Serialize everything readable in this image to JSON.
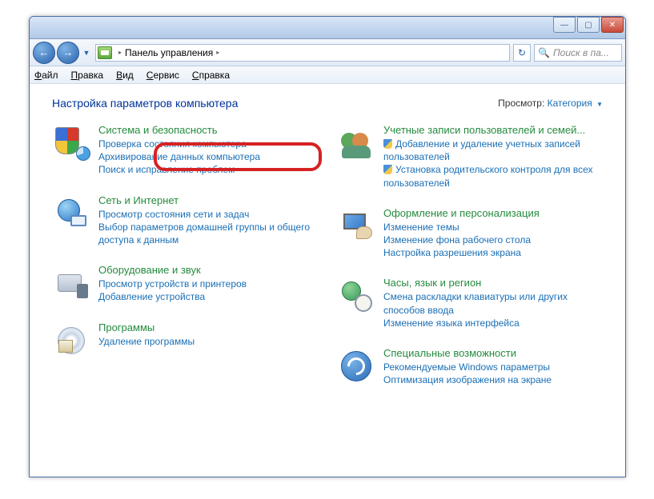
{
  "window_controls": {
    "min": "—",
    "max": "▢",
    "close": "✕"
  },
  "nav": {
    "back": "←",
    "forward": "→",
    "dropdown": "▼",
    "refresh": "↻"
  },
  "breadcrumb": {
    "root": "Панель управления",
    "sep": "▸"
  },
  "search": {
    "placeholder": "Поиск в па..."
  },
  "menu": {
    "file": "Файл",
    "edit": "Правка",
    "view": "Вид",
    "service": "Сервис",
    "help": "Справка"
  },
  "page_title": "Настройка параметров компьютера",
  "view_by": {
    "label": "Просмотр:",
    "value": "Категория",
    "arrow": "▼"
  },
  "categories": {
    "left": [
      {
        "title": "Система и безопасность",
        "links": [
          {
            "text": "Проверка состояния компьютера",
            "shield": false
          },
          {
            "text": "Архивирование данных компьютера",
            "shield": false
          },
          {
            "text": "Поиск и исправление проблем",
            "shield": false
          }
        ]
      },
      {
        "title": "Сеть и Интернет",
        "links": [
          {
            "text": "Просмотр состояния сети и задач",
            "shield": false
          },
          {
            "text": "Выбор параметров домашней группы и общего доступа к данным",
            "shield": false
          }
        ]
      },
      {
        "title": "Оборудование и звук",
        "links": [
          {
            "text": "Просмотр устройств и принтеров",
            "shield": false
          },
          {
            "text": "Добавление устройства",
            "shield": false
          }
        ]
      },
      {
        "title": "Программы",
        "links": [
          {
            "text": "Удаление программы",
            "shield": false
          }
        ]
      }
    ],
    "right": [
      {
        "title": "Учетные записи пользователей и семей...",
        "links": [
          {
            "text": "Добавление и удаление учетных записей пользователей",
            "shield": true
          },
          {
            "text": "Установка родительского контроля для всех пользователей",
            "shield": true
          }
        ]
      },
      {
        "title": "Оформление и персонализация",
        "links": [
          {
            "text": "Изменение темы",
            "shield": false
          },
          {
            "text": "Изменение фона рабочего стола",
            "shield": false
          },
          {
            "text": "Настройка разрешения экрана",
            "shield": false
          }
        ]
      },
      {
        "title": "Часы, язык и регион",
        "links": [
          {
            "text": "Смена раскладки клавиатуры или других способов ввода",
            "shield": false
          },
          {
            "text": "Изменение языка интерфейса",
            "shield": false
          }
        ]
      },
      {
        "title": "Специальные возможности",
        "links": [
          {
            "text": "Рекомендуемые Windows параметры",
            "shield": false
          },
          {
            "text": "Оптимизация изображения на экране",
            "shield": false
          }
        ]
      }
    ]
  }
}
